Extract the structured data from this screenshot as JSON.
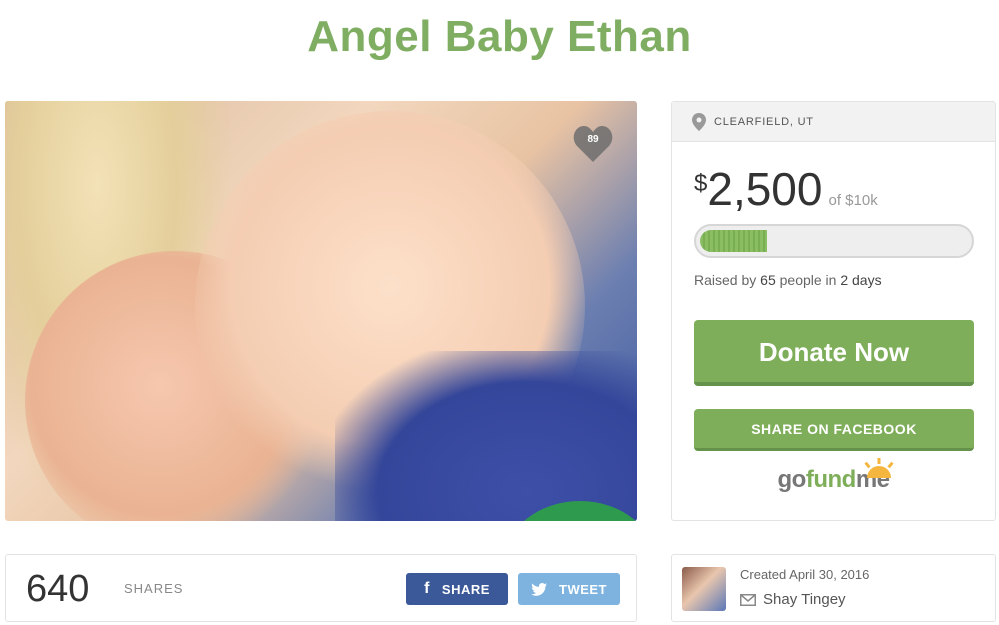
{
  "campaign": {
    "title": "Angel Baby Ethan",
    "likes": "89"
  },
  "panel": {
    "location": "CLEARFIELD, UT",
    "currency_symbol": "$",
    "amount_raised": "2,500",
    "goal_text": "of $10k",
    "progress_fraction": 0.25,
    "raised_prefix": "Raised by",
    "donor_count": "65",
    "raised_mid": "people in",
    "days": "2 days",
    "donate_label": "Donate Now",
    "facebook_label": "SHARE ON FACEBOOK",
    "logo": {
      "go": "go",
      "fund": "fund",
      "me": "me"
    }
  },
  "sharebar": {
    "count": "640",
    "label": "SHARES",
    "facebook_label": "SHARE",
    "twitter_label": "TWEET"
  },
  "creator": {
    "created_text": "Created April 30, 2016",
    "name": "Shay Tingey"
  },
  "icons": {
    "heart": "heart-icon",
    "pin": "location-pin-icon",
    "facebook": "facebook-icon",
    "twitter": "twitter-icon",
    "mail": "envelope-icon"
  },
  "colors": {
    "brand_green": "#7fae5b",
    "title_green": "#7fae63",
    "facebook_blue": "#3b5998",
    "twitter_blue": "#7eb3e0"
  }
}
